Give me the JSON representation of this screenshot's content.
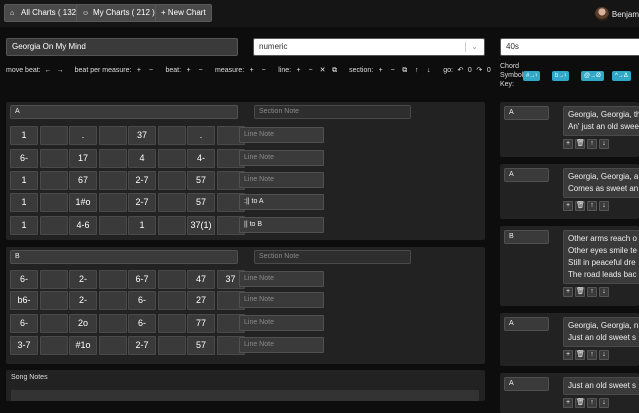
{
  "nav": {
    "all_charts": "All Charts ( 132 )",
    "my_charts": "My Charts ( 212 )",
    "new_chart": "+ New Chart",
    "user_name": "Benjam"
  },
  "header": {
    "title_value": "Georgia On My Mind",
    "notation_value": "numeric",
    "genre_value": "40s"
  },
  "toolbar": {
    "move_beat": "move beat:",
    "beat_per_measure": "beat per measure:",
    "beat": "beat:",
    "measure": "measure:",
    "line": "line:",
    "section": "section:",
    "go": "go:",
    "undo_count": "0",
    "redo_count": "0"
  },
  "chord_key": {
    "label_1": "Chord",
    "label_2": "Symbol",
    "label_3": "Key:",
    "badges": [
      "#→♮",
      "b→♮",
      "@→Ø",
      "^→Δ"
    ]
  },
  "sections": [
    {
      "name": "A",
      "note_placeholder": "Section Note",
      "rows": [
        {
          "cells": [
            "1",
            "",
            ".",
            "",
            "37",
            "",
            ".",
            ""
          ],
          "note": "",
          "note_placeholder": "Line Note"
        },
        {
          "cells": [
            "6-",
            "",
            "17",
            "",
            "4",
            "",
            "4-",
            ""
          ],
          "note": "",
          "note_placeholder": "Line Note"
        },
        {
          "cells": [
            "1",
            "",
            "67",
            "",
            "2-7",
            "",
            "57",
            ""
          ],
          "note": "",
          "note_placeholder": "Line Note"
        },
        {
          "cells": [
            "1",
            "",
            "1#o",
            "",
            "2-7",
            "",
            "57",
            ""
          ],
          "note": ":|| to A",
          "note_placeholder": "Line Note"
        },
        {
          "cells": [
            "1",
            "",
            "4-6",
            "",
            "1",
            "",
            "37(1)",
            ""
          ],
          "note": "|| to B",
          "note_placeholder": "Line Note"
        }
      ]
    },
    {
      "name": "B",
      "note_placeholder": "Section Note",
      "rows": [
        {
          "cells": [
            "6-",
            "",
            "2-",
            "",
            "6-7",
            "",
            "47",
            "37"
          ],
          "note": "",
          "note_placeholder": "Line Note"
        },
        {
          "cells": [
            "b6-",
            "",
            "2-",
            "",
            "6-",
            "",
            "27",
            ""
          ],
          "note": "",
          "note_placeholder": "Line Note"
        },
        {
          "cells": [
            "6-",
            "",
            "2o",
            "",
            "6-",
            "",
            "77",
            ""
          ],
          "note": "",
          "note_placeholder": "Line Note"
        },
        {
          "cells": [
            "3-7",
            "",
            "#1o",
            "",
            "2-7",
            "",
            "57",
            ""
          ],
          "note": "",
          "note_placeholder": "Line Note"
        }
      ]
    }
  ],
  "song_notes": {
    "label": "Song Notes"
  },
  "lyrics": [
    {
      "name": "A",
      "lines": [
        "Georgia, Georgia, the",
        "An' just an old swee"
      ]
    },
    {
      "name": "A",
      "lines": [
        "Georgia, Georgia, a",
        "Comes as sweet an"
      ]
    },
    {
      "name": "B",
      "lines": [
        "Other arms reach o",
        "Other eyes smile te",
        "Still in peaceful dre",
        "The road leads bac"
      ]
    },
    {
      "name": "A",
      "lines": [
        "Georgia, Georgia, n",
        "Just an old sweet s"
      ]
    },
    {
      "name": "A",
      "lines": [
        "Just an old sweet s"
      ]
    }
  ]
}
